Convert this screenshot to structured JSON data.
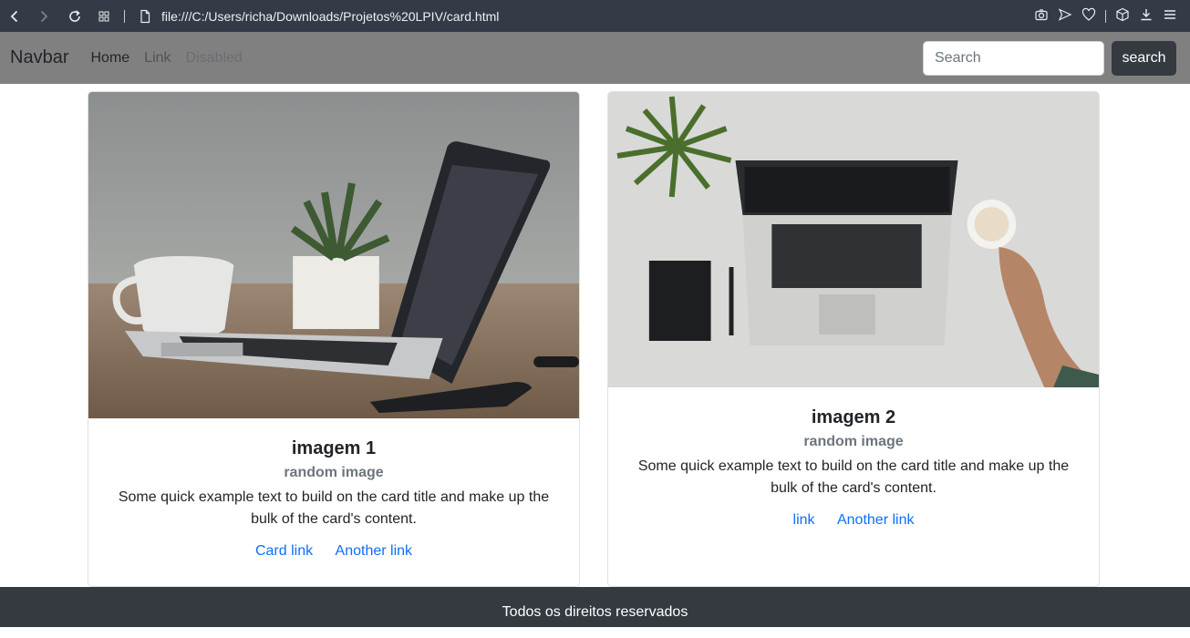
{
  "browser": {
    "url": "file:///C:/Users/richa/Downloads/Projetos%20LPIV/card.html"
  },
  "navbar": {
    "brand": "Navbar",
    "links": [
      "Home",
      "Link",
      "Disabled"
    ],
    "search_placeholder": "Search",
    "search_button": "search"
  },
  "cards": [
    {
      "title": "imagem 1",
      "subtitle": "random image",
      "text": "Some quick example text to build on the card title and make up the bulk of the card's content.",
      "links": [
        "Card link",
        "Another link"
      ]
    },
    {
      "title": "imagem 2",
      "subtitle": "random image",
      "text": "Some quick example text to build on the card title and make up the bulk of the card's content.",
      "links": [
        "link",
        "Another link"
      ]
    }
  ],
  "footer": {
    "text": "Todos os direitos reservados"
  },
  "colors": {
    "navbar_bg": "#808080",
    "footer_bg": "#343a40",
    "link": "#0d6efd",
    "chrome_bg": "#353b46"
  }
}
